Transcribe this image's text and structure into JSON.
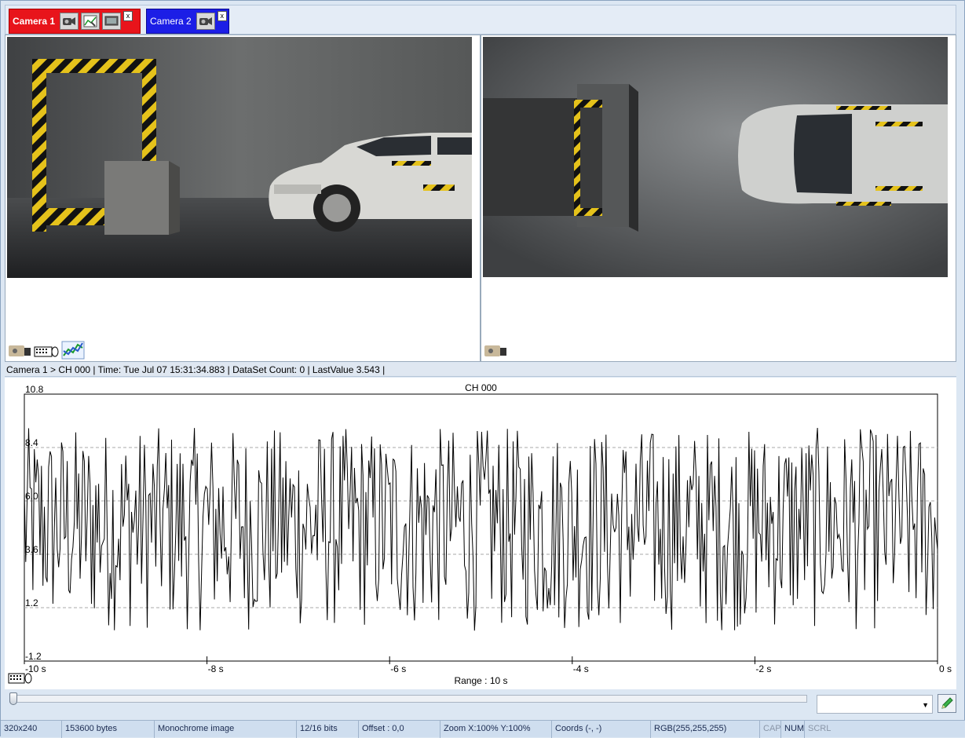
{
  "tabs": [
    {
      "label": "Camera 1",
      "color": "#e8141b",
      "close": "x"
    },
    {
      "label": "Camera 2",
      "color": "#1c1ee6",
      "close": "x"
    }
  ],
  "info_bar": "Camera 1 > CH 000 | Time: Tue Jul 07 15:31:34.883 | DataSet Count: 0 | LastValue 3.543 |",
  "chart_data": {
    "type": "line",
    "title": "CH 000",
    "xlabel": "Range : 10 s",
    "ylabel": "",
    "x_ticks": [
      "-10 s",
      "-8 s",
      "-6 s",
      "-4 s",
      "-2 s",
      "0 s"
    ],
    "y_ticks": [
      "10.8",
      "8.4",
      "6.0",
      "3.6",
      "1.2",
      "-1.2"
    ],
    "xlim": [
      -10,
      0
    ],
    "ylim": [
      -1.2,
      10.8
    ],
    "grid": true,
    "series": [
      {
        "color": "#000000",
        "approx_min": 0.1,
        "approx_max": 9.3,
        "approx_mean": 4.8,
        "description_points": "dense noise ~600 samples"
      }
    ]
  },
  "slider": {
    "position": 0.0
  },
  "combo": {
    "value": ""
  },
  "status": [
    {
      "text": "320x240"
    },
    {
      "text": "153600 bytes"
    },
    {
      "text": "Monochrome image"
    },
    {
      "text": "12/16 bits"
    },
    {
      "text": "Offset : 0,0"
    },
    {
      "text": "Zoom X:100%  Y:100%"
    },
    {
      "text": "Coords (-, -)"
    },
    {
      "text": "RGB(255,255,255)"
    },
    {
      "text": "CAP",
      "dim": true
    },
    {
      "text": "NUM"
    },
    {
      "text": "SCRL",
      "dim": true
    }
  ]
}
